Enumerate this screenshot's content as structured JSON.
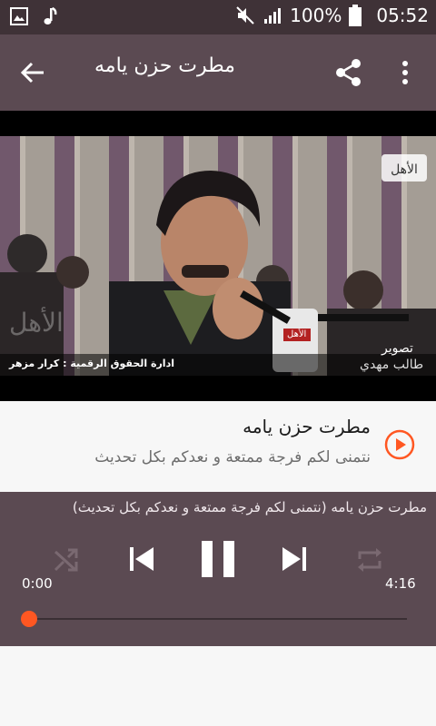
{
  "status_bar": {
    "battery": "100%",
    "time": "05:52",
    "icons": [
      "image-icon",
      "music-note-icon",
      "mute-icon",
      "signal-icon",
      "battery-icon"
    ]
  },
  "app_bar": {
    "title": "مطرت حزن يامه",
    "icons": [
      "back-arrow-icon",
      "share-icon",
      "more-vert-icon"
    ]
  },
  "video": {
    "overlay_text_top_right": "الأهل",
    "overlay_credit": "ادارة الحقوق الرقمية : كرار مزهر",
    "overlay_photo_label": "تصوير",
    "overlay_photo_name": "طالب مهدي",
    "mic_label": "الأهل"
  },
  "track": {
    "title": "مطرت حزن يامه",
    "subtitle": "نتمنى لكم فرجة ممتعة و نعدكم بكل تحديث"
  },
  "player": {
    "now_playing": "مطرت حزن يامه (نتمنى لكم فرجة ممتعة و نعدكم بكل تحديث)",
    "elapsed": "0:00",
    "duration": "4:16",
    "progress": 0.0,
    "accent_color": "#ff5722"
  }
}
